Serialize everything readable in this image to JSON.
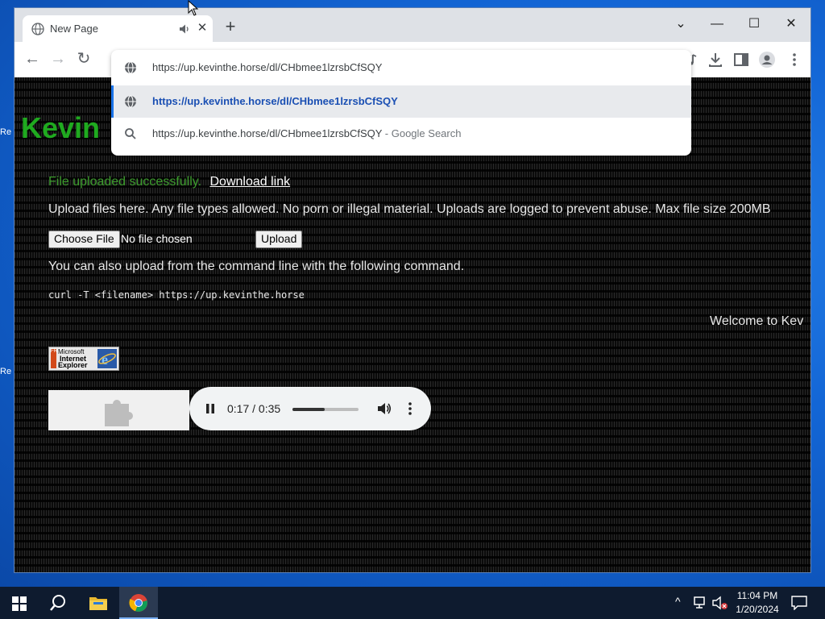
{
  "desktop": {
    "labels": [
      "Re",
      "Re"
    ]
  },
  "browser": {
    "tab": {
      "title": "New Page"
    },
    "omnibox": {
      "url": "https://up.kevinthe.horse/dl/CHbmee1lzrsbCfSQY",
      "suggestions": [
        {
          "text": "https://up.kevinthe.horse/dl/CHbmee1lzrsbCfSQY",
          "type": "url"
        },
        {
          "text": "https://up.kevinthe.horse/dl/CHbmee1lzrsbCfSQY",
          "suffix": " - Google Search",
          "type": "search"
        }
      ]
    }
  },
  "page": {
    "site_title": "Kevin",
    "upload_status": "File uploaded successfully.",
    "download_link": "Download link",
    "info": "Upload files here. Any file types allowed. No porn or illegal material. Uploads are logged to prevent abuse. Max file size 200MB",
    "choose_file_label": "Choose File",
    "no_file_text": "No file chosen",
    "upload_label": "Upload",
    "cli_info": "You can also upload from the command line with the following command.",
    "cli_command": "curl -T <filename> https://up.kevinthe.horse",
    "welcome": "Welcome to Kev",
    "ie_badge": {
      "free": "FREE",
      "line1": "Microsoft",
      "line2": "Internet",
      "line3": "Explorer"
    },
    "audio": {
      "time": "0:17 / 0:35",
      "progress": 0.49
    }
  },
  "taskbar": {
    "time": "11:04 PM",
    "date": "1/20/2024"
  },
  "colors": {
    "site_title": "#1faa1f",
    "success": "#3c9b2d",
    "omnibox_selected_text": "#1a4fb3",
    "taskbar": "#0e1b2f"
  }
}
